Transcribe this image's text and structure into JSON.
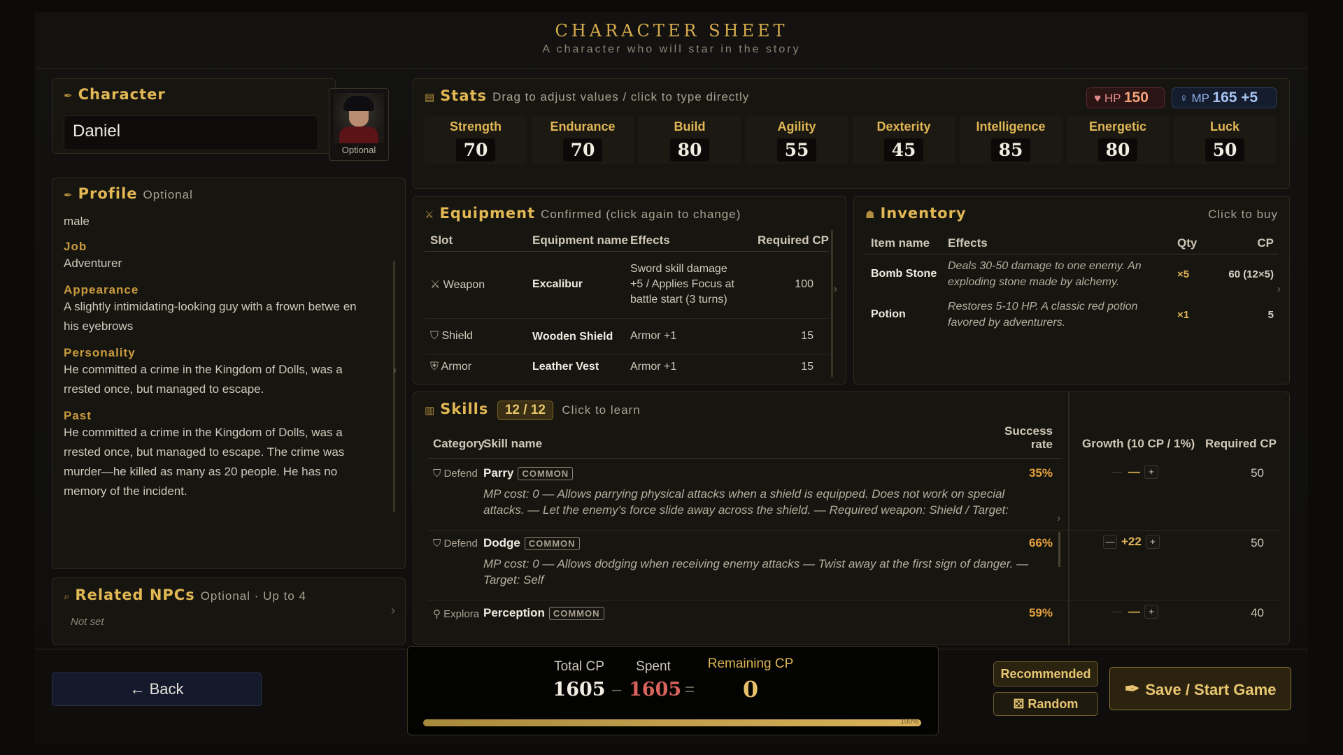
{
  "header": {
    "title": "CHARACTER SHEET",
    "subtitle": "A character who will star in the story"
  },
  "character": {
    "title": "Character",
    "name": "Daniel",
    "portrait_caption": "Optional"
  },
  "profile": {
    "title": "Profile",
    "hint": "Optional",
    "gender": "male",
    "job_label": "Job",
    "job": "Adventurer",
    "appearance_label": "Appearance",
    "appearance": "A slightly intimidating-looking guy with a frown betwe en his eyebrows",
    "personality_label": "Personality",
    "personality": "He committed a crime in the Kingdom of Dolls, was a rrested once, but managed to escape.",
    "past_label": "Past",
    "past": "He committed a crime in the Kingdom of Dolls, was a rrested once, but managed to escape. The crime was murder—he killed as many as 20 people. He has no memory of the incident."
  },
  "npcs": {
    "title": "Related NPCs",
    "hint": "Optional · Up to 4",
    "value": "Not set"
  },
  "stats": {
    "title": "Stats",
    "hint": "Drag to adjust values / click to type directly",
    "hp_label": "HP",
    "hp": "150",
    "mp_label": "MP",
    "mp": "165 +5",
    "items": [
      {
        "label": "Strength",
        "value": "70"
      },
      {
        "label": "Endurance",
        "value": "70"
      },
      {
        "label": "Build",
        "value": "80"
      },
      {
        "label": "Agility",
        "value": "55"
      },
      {
        "label": "Dexterity",
        "value": "45"
      },
      {
        "label": "Intelligence",
        "value": "85"
      },
      {
        "label": "Energetic",
        "value": "80"
      },
      {
        "label": "Luck",
        "value": "50"
      }
    ]
  },
  "equipment": {
    "title": "Equipment",
    "hint": "Confirmed (click again to change)",
    "columns": [
      "Slot",
      "Equipment name",
      "Effects",
      "Required CP"
    ],
    "rows": [
      {
        "slot": "Weapon",
        "name": "Excalibur",
        "effects": "Sword skill damage +5 / Applies Focus at battle start (3 turns)",
        "cp": "100"
      },
      {
        "slot": "Shield",
        "name": "Wooden Shield",
        "effects": "Armor +1",
        "cp": "15"
      },
      {
        "slot": "Armor",
        "name": "Leather Vest",
        "effects": "Armor +1",
        "cp": "15"
      }
    ]
  },
  "inventory": {
    "title": "Inventory",
    "hint": "Click to buy",
    "columns": [
      "Item name",
      "Effects",
      "Qty",
      "CP"
    ],
    "rows": [
      {
        "name": "Bomb Stone",
        "effects": "Deals 30-50 damage to one enemy. An exploding stone made by alchemy.",
        "qty": "×5",
        "cp": "60 (12×5)"
      },
      {
        "name": "Potion",
        "effects": "Restores 5-10 HP. A classic red potion favored by adventurers.",
        "qty": "×1",
        "cp": "5"
      }
    ]
  },
  "skills": {
    "title": "Skills",
    "count": "12 / 12",
    "hint": "Click to learn",
    "columns": [
      "Category",
      "Skill name",
      "Success rate",
      "Growth (10 CP / 1%)",
      "Required CP"
    ],
    "rows": [
      {
        "category": "Defend",
        "name": "Parry",
        "tag": "COMMON",
        "rate": "35%",
        "growth": "—",
        "cp": "50",
        "desc": "MP cost: 0 — Allows parrying physical attacks when a shield is equipped. Does not work on special attacks. — Let the enemy's force slide away across the shield. — Required weapon: Shield / Target:"
      },
      {
        "category": "Defend",
        "name": "Dodge",
        "tag": "COMMON",
        "rate": "66%",
        "growth": "+22",
        "cp": "50",
        "desc": "MP cost: 0 — Allows dodging when receiving enemy attacks — Twist away at the first sign of danger. — Target: Self"
      },
      {
        "category": "Explora",
        "name": "Perception",
        "tag": "COMMON",
        "rate": "59%",
        "growth": "—",
        "cp": "40",
        "desc": ""
      }
    ]
  },
  "footer": {
    "back": "← Back",
    "total_label": "Total CP",
    "total": "1605",
    "spent_label": "Spent",
    "spent": "1605",
    "remaining_label": "Remaining CP",
    "remaining": "0",
    "progress_pct": 100,
    "progress_label": "100%",
    "recommended": "Recommended",
    "random": "Random",
    "save": "Save / Start Game"
  }
}
